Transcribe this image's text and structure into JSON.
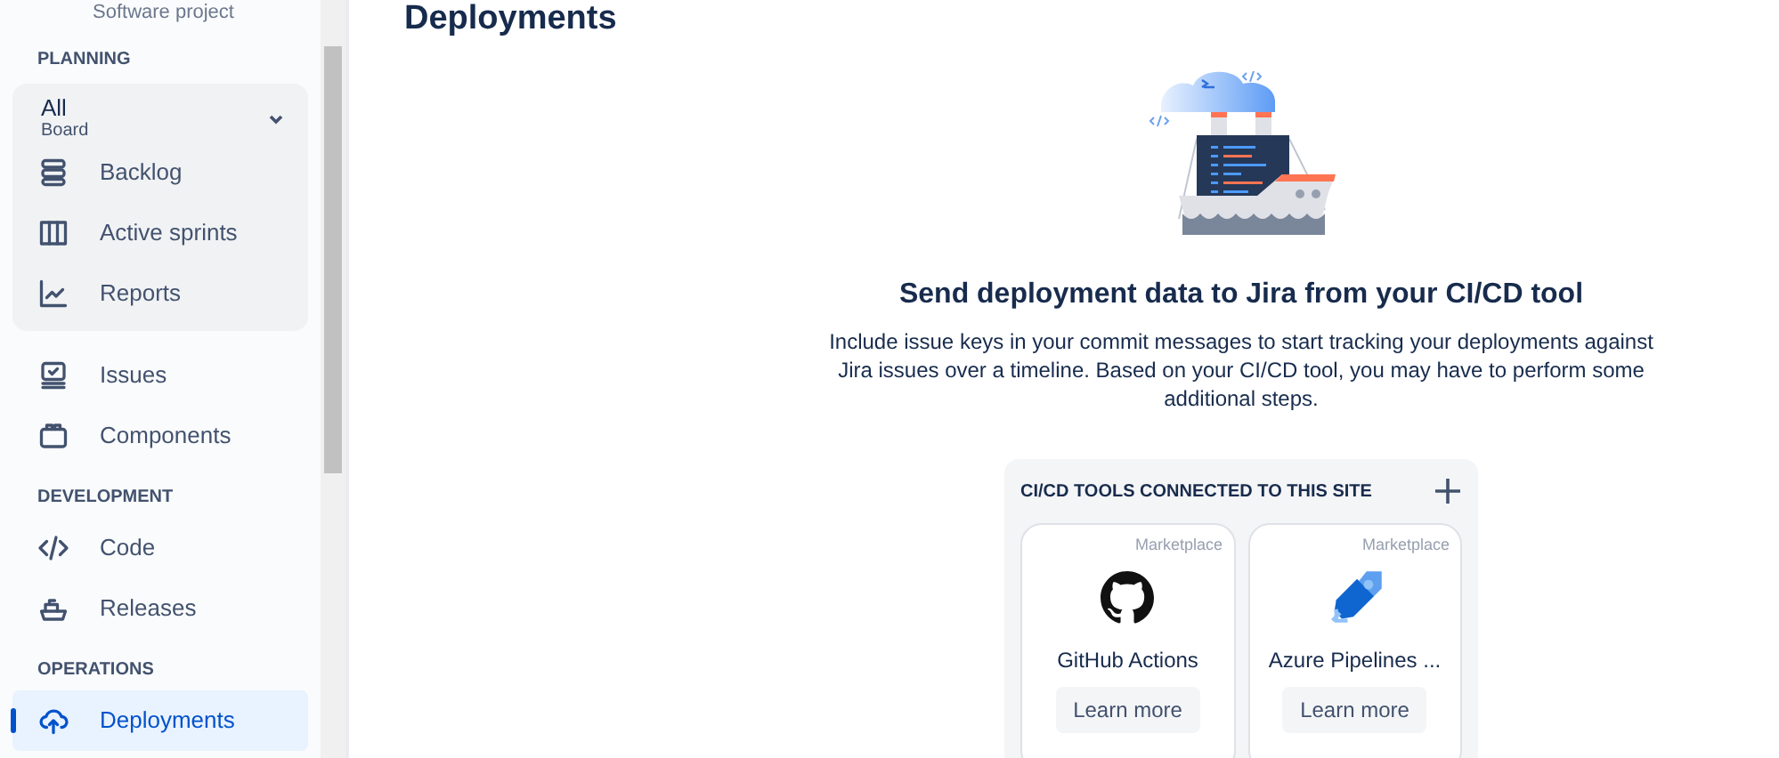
{
  "project": {
    "type": "Software project"
  },
  "sidebar": {
    "sections": [
      {
        "title": "PLANNING",
        "board": {
          "name": "All",
          "type": "Board",
          "expanded": true
        },
        "items": [
          {
            "label": "Backlog",
            "selected": false
          },
          {
            "label": "Active sprints",
            "selected": false
          },
          {
            "label": "Reports",
            "selected": false
          }
        ],
        "after": [
          {
            "label": "Issues",
            "selected": false
          },
          {
            "label": "Components",
            "selected": false
          }
        ]
      },
      {
        "title": "DEVELOPMENT",
        "items": [
          {
            "label": "Code",
            "selected": false
          },
          {
            "label": "Releases",
            "selected": false
          }
        ]
      },
      {
        "title": "OPERATIONS",
        "items": [
          {
            "label": "Deployments",
            "selected": true
          }
        ]
      }
    ]
  },
  "page": {
    "title": "Deployments",
    "heading": "Send deployment data to Jira from your CI/CD tool",
    "description": "Include issue keys in your commit messages to start tracking your deployments against Jira issues over a timeline. Based on your CI/CD tool, you may have to perform some additional steps.",
    "tools": {
      "title": "CI/CD TOOLS CONNECTED TO THIS SITE",
      "cards": [
        {
          "tag": "Marketplace",
          "name": "GitHub Actions",
          "button": "Learn more"
        },
        {
          "tag": "Marketplace",
          "name": "Azure Pipelines ...",
          "button": "Learn more"
        }
      ]
    }
  }
}
